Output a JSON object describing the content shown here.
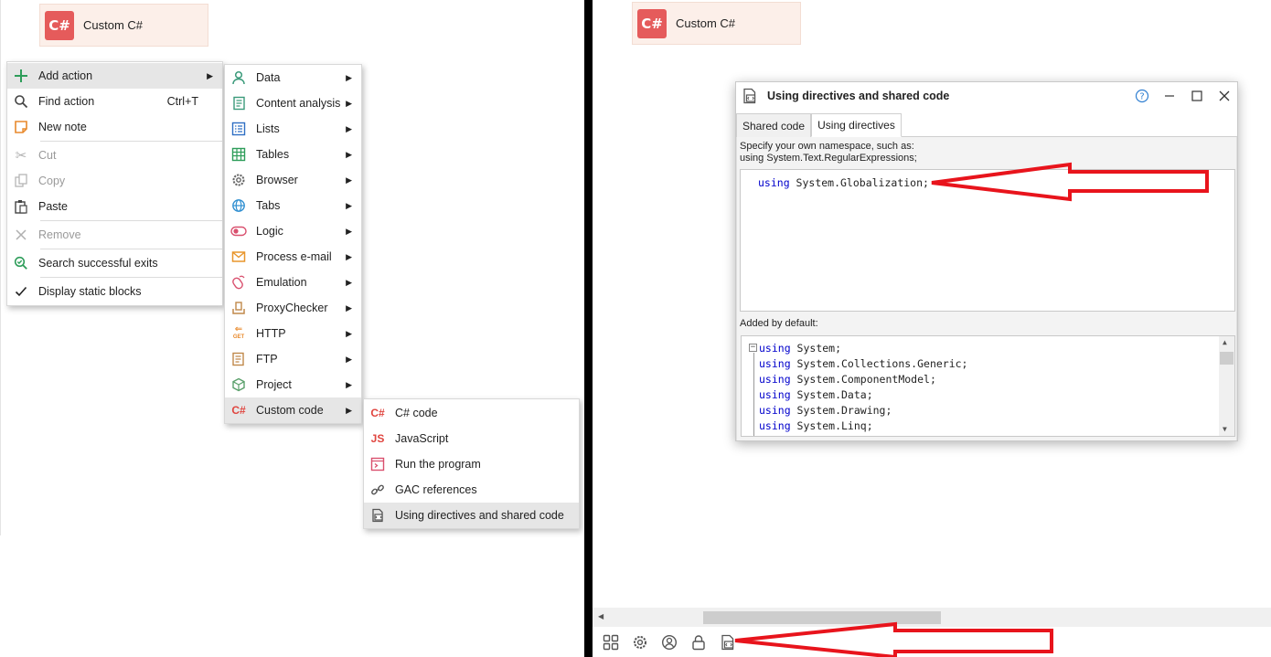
{
  "left": {
    "block_label": "Custom C#",
    "block_badge": "C#",
    "context_menu": {
      "add_action": "Add action",
      "find_action": "Find action",
      "find_shortcut": "Ctrl+T",
      "new_note": "New note",
      "cut": "Cut",
      "copy": "Copy",
      "paste": "Paste",
      "remove": "Remove",
      "search_exits": "Search successful exits",
      "display_static": "Display static blocks"
    },
    "add_action_menu": [
      {
        "label": "Data",
        "icon": "person-icon"
      },
      {
        "label": "Content analysis",
        "icon": "document-icon"
      },
      {
        "label": "Lists",
        "icon": "list-icon"
      },
      {
        "label": "Tables",
        "icon": "table-icon"
      },
      {
        "label": "Browser",
        "icon": "gear-icon"
      },
      {
        "label": "Tabs",
        "icon": "globe-icon"
      },
      {
        "label": "Logic",
        "icon": "toggle-icon"
      },
      {
        "label": "Process e-mail",
        "icon": "envelope-icon"
      },
      {
        "label": "Emulation",
        "icon": "mouse-icon"
      },
      {
        "label": "ProxyChecker",
        "icon": "proxy-icon"
      },
      {
        "label": "HTTP",
        "icon": "get-icon"
      },
      {
        "label": "FTP",
        "icon": "ftp-icon"
      },
      {
        "label": "Project",
        "icon": "cube-icon"
      },
      {
        "label": "Custom code",
        "icon": "csharp-icon"
      }
    ],
    "custom_code_menu": {
      "csharp": "C# code",
      "javascript": "JavaScript",
      "run_program": "Run the program",
      "gac": "GAC references",
      "using": "Using directives and shared code"
    },
    "icon_text": {
      "csharp": "C#",
      "js": "JS",
      "get": "GET"
    }
  },
  "right": {
    "block_label": "Custom C#",
    "block_badge": "C#",
    "window": {
      "title": "Using directives and shared code",
      "tab_shared": "Shared code",
      "tab_using": "Using directives",
      "hint_line1": "Specify your own namespace, such as:",
      "hint_line2": "using System.Text.RegularExpressions;",
      "user_code_kw": "using",
      "user_code_rest": " System.Globalization;",
      "added_by_default": "Added by default:",
      "default_lines": [
        {
          "kw": "using",
          "rest": " System;"
        },
        {
          "kw": "using",
          "rest": " System.Collections.Generic;"
        },
        {
          "kw": "using",
          "rest": " System.ComponentModel;"
        },
        {
          "kw": "using",
          "rest": " System.Data;"
        },
        {
          "kw": "using",
          "rest": " System.Drawing;"
        },
        {
          "kw": "using",
          "rest": " System.Linq;"
        }
      ]
    }
  },
  "colors": {
    "accent_red": "#e8141c",
    "csharp_badge": "#e55b5b",
    "keyword": "#0000cc",
    "highlight": "#e6e6e6"
  }
}
